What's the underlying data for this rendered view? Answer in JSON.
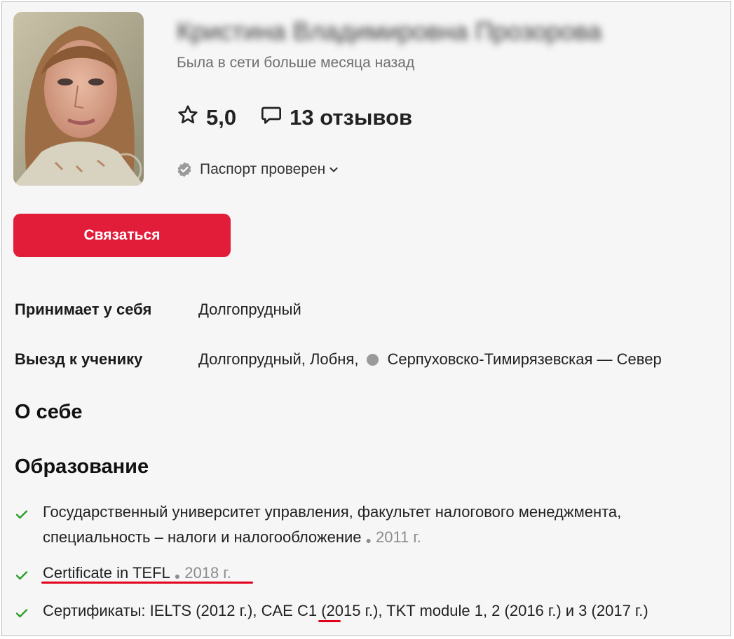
{
  "profile": {
    "name": "Кристина Владимировна Прозорова",
    "last_seen": "Была в сети больше месяца назад",
    "rating": "5,0",
    "reviews": "13 отзывов",
    "passport": "Паспорт проверен",
    "contact_label": "Связаться"
  },
  "details": {
    "home_label": "Принимает у себя",
    "home_value": "Долгопрудный",
    "visit_label": "Выезд к ученику",
    "visit_value": "Долгопрудный, Лобня,",
    "visit_metro": "Серпуховско-Тимирязевская — Север"
  },
  "sections": {
    "about_title": "О себе",
    "education_title": "Образование"
  },
  "education": [
    {
      "line1": "Государственный университет управления, факультет налогового менеджмента,",
      "line2": "специальность – налоги и налогообложение",
      "year": "2011 г."
    },
    {
      "text": "Certificate in TEFL",
      "year": "2018 г."
    },
    {
      "text_before": "Сертификаты: IELTS (2012 г.), CAE ",
      "text_highlight": "C1",
      "text_after": " (2015 г.), TKT module 1, 2 (2016 г.) и 3 (2017 г.)"
    }
  ],
  "colors": {
    "accent": "#e11d3a",
    "check": "#2e9e2e",
    "annotation": "#e0001b"
  }
}
